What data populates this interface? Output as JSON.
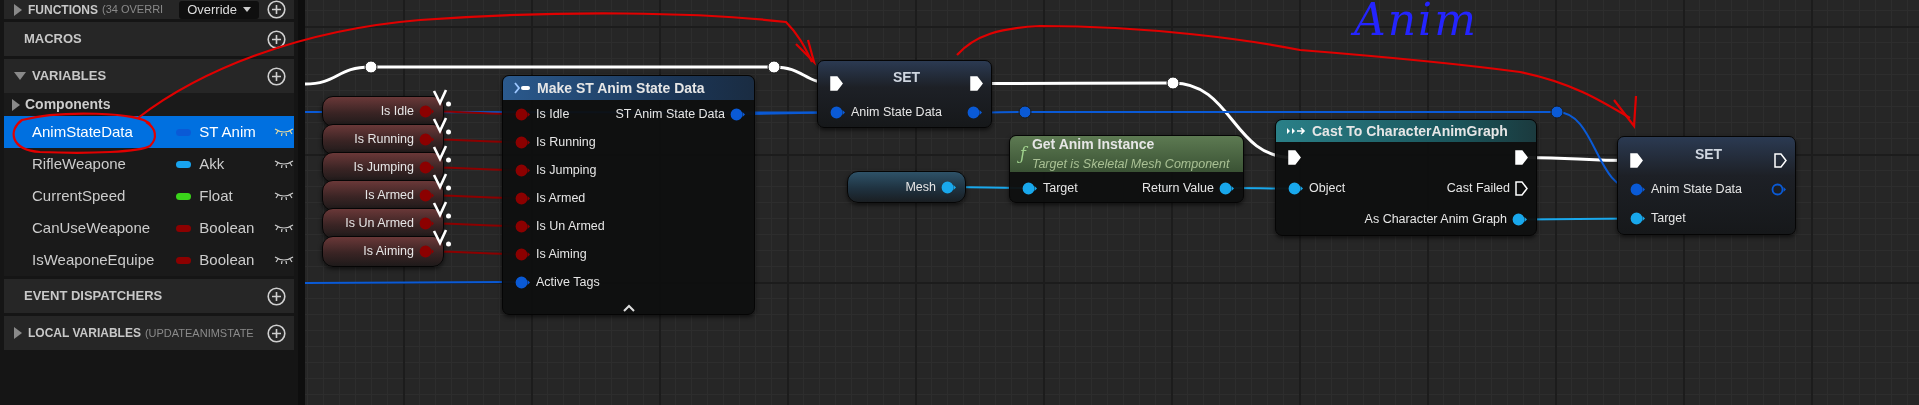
{
  "sidebar": {
    "sections": [
      {
        "title": "FUNCTIONS",
        "note": "(34 OVERRI",
        "expanded": false,
        "dropdown": "Override"
      },
      {
        "title": "MACROS"
      },
      {
        "title": "VARIABLES",
        "expanded": true,
        "categories": [
          {
            "label": "Components",
            "expanded": false
          }
        ],
        "variables": [
          {
            "name": "AnimStateData",
            "type": "ST Anim",
            "color": "#0a5ad6",
            "selected": true
          },
          {
            "name": "RifleWeapone",
            "type": "Akk",
            "color": "#18a4f0",
            "selected": false
          },
          {
            "name": "CurrentSpeed",
            "type": "Float",
            "color": "#3ad41a",
            "selected": false
          },
          {
            "name": "CanUseWeapone",
            "type": "Boolean",
            "color": "#8c0000",
            "selected": false
          },
          {
            "name": "IsWeaponeEquipe",
            "type": "Boolean",
            "color": "#8c0000",
            "selected": false
          }
        ]
      },
      {
        "title": "EVENT DISPATCHERS"
      },
      {
        "title": "LOCAL VARIABLES",
        "note": "(UPDATEANIMSTATE",
        "expanded": false
      }
    ]
  },
  "graph": {
    "nodes": [
      {
        "kind": "getter",
        "outputs": [
          {
            "kind": "data",
            "label": "Is Idle",
            "color": "#8c0000",
            "connected": true
          }
        ]
      },
      {
        "kind": "getter",
        "outputs": [
          {
            "kind": "data",
            "label": "Is Running",
            "color": "#8c0000",
            "connected": true
          }
        ]
      },
      {
        "kind": "getter",
        "outputs": [
          {
            "kind": "data",
            "label": "Is Jumping",
            "color": "#8c0000",
            "connected": true
          }
        ]
      },
      {
        "kind": "getter",
        "outputs": [
          {
            "kind": "data",
            "label": "Is Armed",
            "color": "#8c0000",
            "connected": true
          }
        ]
      },
      {
        "kind": "getter",
        "outputs": [
          {
            "kind": "data",
            "label": "Is Un Armed",
            "color": "#8c0000",
            "connected": true
          }
        ]
      },
      {
        "kind": "getter",
        "outputs": [
          {
            "kind": "data",
            "label": "Is Aiming",
            "color": "#8c0000",
            "connected": true
          }
        ]
      },
      {
        "kind": "make",
        "title": "Make ST Anim State Data",
        "inputs": [
          {
            "kind": "data",
            "label": "Is Idle",
            "color": "#8c0000",
            "connected": true
          },
          {
            "kind": "data",
            "label": "Is Running",
            "color": "#8c0000",
            "connected": true
          },
          {
            "kind": "data",
            "label": "Is Jumping",
            "color": "#8c0000",
            "connected": true
          },
          {
            "kind": "data",
            "label": "Is Armed",
            "color": "#8c0000",
            "connected": true
          },
          {
            "kind": "data",
            "label": "Is Un Armed",
            "color": "#8c0000",
            "connected": true
          },
          {
            "kind": "data",
            "label": "Is Aiming",
            "color": "#8c0000",
            "connected": true
          },
          {
            "kind": "data",
            "label": "Active Tags",
            "color": "#0a5ad6",
            "connected": true
          }
        ],
        "outputs": [
          {
            "kind": "data",
            "label": "ST Anim State Data",
            "color": "#0a5ad6",
            "connected": true
          }
        ]
      },
      {
        "kind": "set",
        "title": "SET",
        "inputs": [
          {
            "kind": "exec",
            "connected": true
          },
          {
            "kind": "data",
            "label": "Anim State Data",
            "color": "#0a5ad6",
            "connected": true
          }
        ],
        "outputs": [
          {
            "kind": "exec",
            "connected": true
          },
          {
            "kind": "data",
            "color": "#0a5ad6",
            "connected": true
          }
        ]
      },
      {
        "kind": "getter",
        "outputs": [
          {
            "kind": "data",
            "label": "Mesh",
            "color": "#19a8ec",
            "connected": true
          }
        ]
      },
      {
        "kind": "function",
        "glyph": "ƒ",
        "title": "Get Anim Instance",
        "subtitle": "Target is Skeletal Mesh Component",
        "inputs": [
          {
            "kind": "data",
            "label": "Target",
            "color": "#19a8ec",
            "connected": true
          }
        ],
        "outputs": [
          {
            "kind": "data",
            "label": "Return Value",
            "color": "#19a8ec",
            "connected": true
          }
        ]
      },
      {
        "kind": "cast",
        "title": "Cast To CharacterAnimGraph",
        "inputs": [
          {
            "kind": "exec",
            "connected": true
          },
          {
            "kind": "data",
            "label": "Object",
            "color": "#19a8ec",
            "connected": true
          }
        ],
        "outputs": [
          {
            "kind": "exec",
            "connected": true
          },
          {
            "kind": "exec",
            "label": "Cast Failed",
            "connected": false
          },
          {
            "kind": "data",
            "label": "As Character Anim Graph",
            "color": "#19a8ec",
            "connected": true
          }
        ]
      },
      {
        "kind": "set",
        "title": "SET",
        "inputs": [
          {
            "kind": "exec",
            "connected": true
          },
          {
            "kind": "data",
            "label": "Anim State Data",
            "color": "#0a5ad6",
            "connected": true
          },
          {
            "kind": "data",
            "label": "Target",
            "color": "#19a8ec",
            "connected": true
          }
        ],
        "outputs": [
          {
            "kind": "exec",
            "connected": false
          },
          {
            "kind": "data",
            "color": "#0a5ad6",
            "connected": false
          }
        ]
      }
    ],
    "annotation_text": "Anim"
  }
}
